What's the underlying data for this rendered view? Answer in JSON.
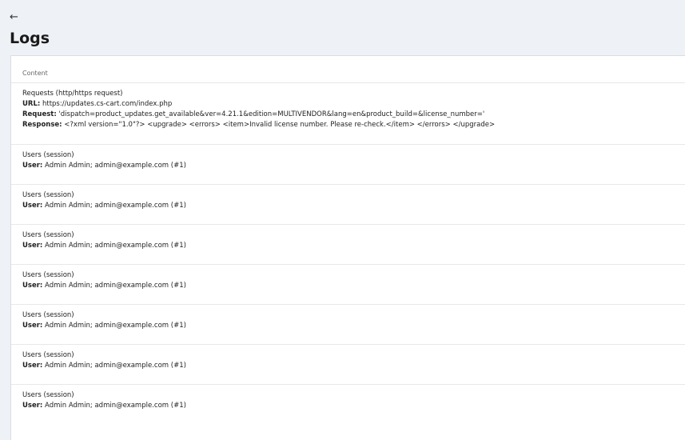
{
  "header": {
    "back_icon": "arrow-left-icon",
    "title": "Logs"
  },
  "table": {
    "column_header": "Content",
    "request_entry": {
      "type": "Requests (http/https request)",
      "url_label": "URL:",
      "url_value": "https://updates.cs-cart.com/index.php",
      "request_label": "Request:",
      "request_value": "'dispatch=product_updates.get_available&ver=4.21.1&edition=MULTIVENDOR&lang=en&product_build=&license_number='",
      "response_label": "Response:",
      "response_value": "<?xml version=\"1.0\"?> <upgrade> <errors> <item>Invalid license number. Please re-check.</item> </errors> </upgrade>"
    },
    "session_entries": [
      {
        "type": "Users (session)",
        "user_label": "User:",
        "user_value": "Admin Admin; admin@example.com (#1)"
      },
      {
        "type": "Users (session)",
        "user_label": "User:",
        "user_value": "Admin Admin; admin@example.com (#1)"
      },
      {
        "type": "Users (session)",
        "user_label": "User:",
        "user_value": "Admin Admin; admin@example.com (#1)"
      },
      {
        "type": "Users (session)",
        "user_label": "User:",
        "user_value": "Admin Admin; admin@example.com (#1)"
      },
      {
        "type": "Users (session)",
        "user_label": "User:",
        "user_value": "Admin Admin; admin@example.com (#1)"
      },
      {
        "type": "Users (session)",
        "user_label": "User:",
        "user_value": "Admin Admin; admin@example.com (#1)"
      },
      {
        "type": "Users (session)",
        "user_label": "User:",
        "user_value": "Admin Admin; admin@example.com (#1)"
      }
    ]
  }
}
